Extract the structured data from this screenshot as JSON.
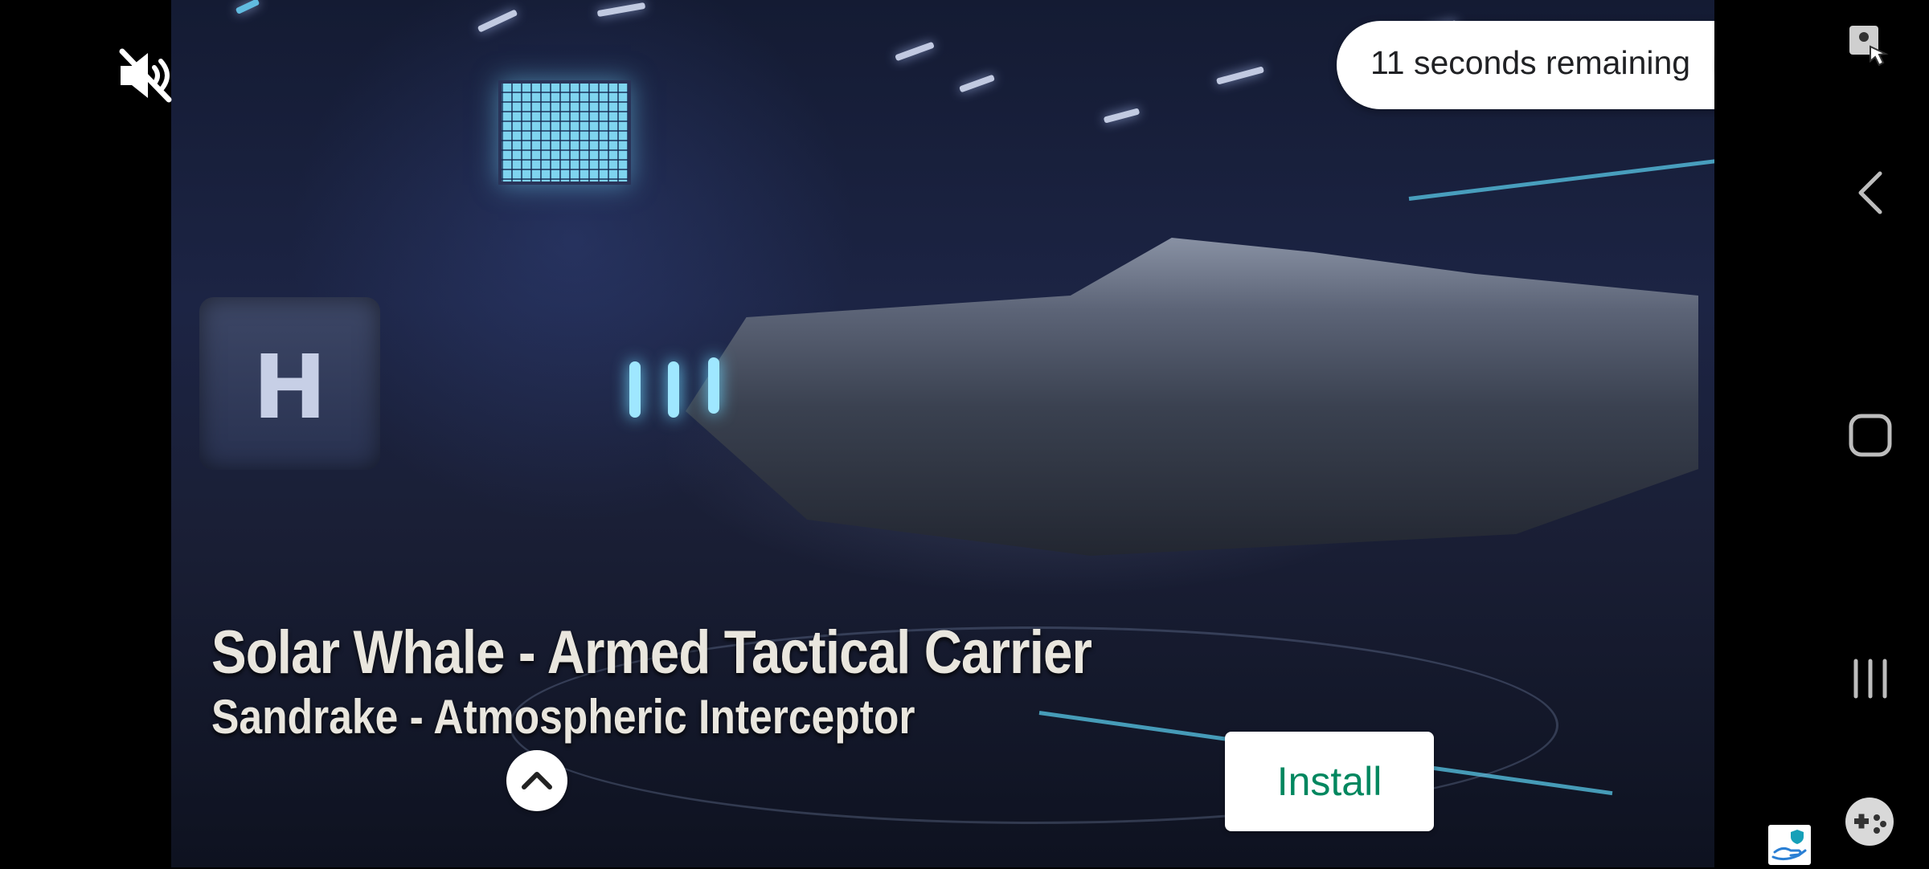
{
  "ad": {
    "title_main": "Solar Whale - Armed Tactical Carrier",
    "title_sub": "Sandrake - Atmospheric Interceptor",
    "helipad_letter": "H",
    "timer_text": "11 seconds remaining",
    "install_label": "Install",
    "install_color": "#01875f"
  },
  "icons": {
    "mute": "speaker-muted-icon",
    "close": "close-icon",
    "expand": "chevron-up-icon",
    "screenshot_tool": "screenshot-touch-icon",
    "back": "back-icon",
    "home": "home-icon",
    "recents": "recent-apps-icon",
    "game_tools": "gamepad-icon",
    "protect": "hand-shield-icon"
  }
}
